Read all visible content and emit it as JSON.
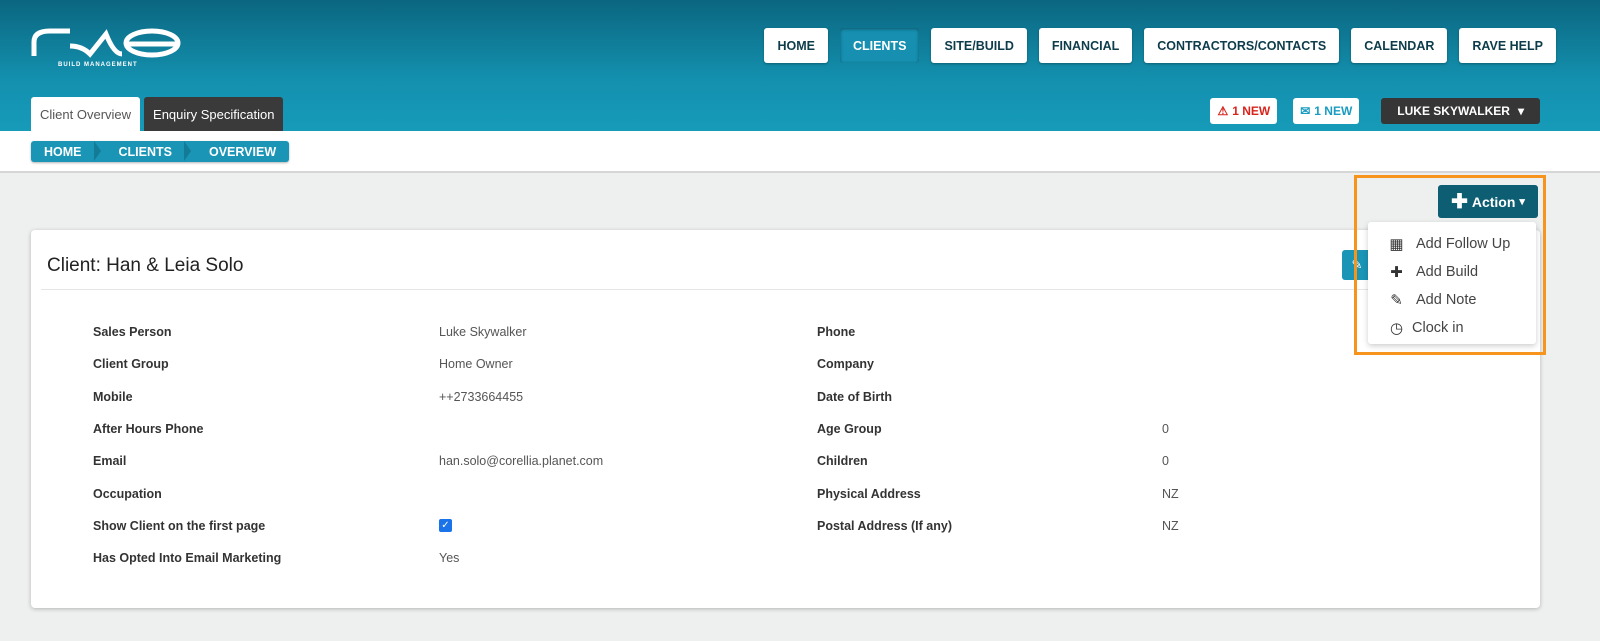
{
  "brand": {
    "logo_text": "rave",
    "tagline": "BUILD MANAGEMENT"
  },
  "nav": [
    "HOME",
    "CLIENTS",
    "SITE/BUILD",
    "FINANCIAL",
    "CONTRACTORS/CONTACTS",
    "CALENDAR",
    "RAVE HELP"
  ],
  "tabs": [
    "Client Overview",
    "Enquiry Specification"
  ],
  "alerts": {
    "warning": "1 NEW",
    "mail": "1 NEW",
    "user": "LUKE SKYWALKER"
  },
  "breadcrumb": [
    "HOME",
    "CLIENTS",
    "OVERVIEW"
  ],
  "action": {
    "label": "Action",
    "items": [
      {
        "icon": "calendar-icon",
        "label": "Add Follow Up"
      },
      {
        "icon": "plus-icon",
        "label": "Add Build"
      },
      {
        "icon": "pencil-icon",
        "label": "Add Note"
      },
      {
        "icon": "clock-icon",
        "label": "Clock in"
      }
    ]
  },
  "client": {
    "title": "Client: Han & Leia Solo",
    "left": [
      {
        "label": "Sales Person",
        "value": "Luke Skywalker"
      },
      {
        "label": "Client Group",
        "value": "Home Owner"
      },
      {
        "label": "Mobile",
        "value": "++2733664455"
      },
      {
        "label": "After Hours Phone",
        "value": ""
      },
      {
        "label": "Email",
        "value": "han.solo@corellia.planet.com"
      },
      {
        "label": "Occupation",
        "value": ""
      },
      {
        "label": "Show Client on the first page",
        "value": ""
      },
      {
        "label": "Has Opted Into Email Marketing",
        "value": "Yes"
      }
    ],
    "right": [
      {
        "label": "Phone",
        "value": ""
      },
      {
        "label": "Company",
        "value": ""
      },
      {
        "label": "Date of Birth",
        "value": ""
      },
      {
        "label": "Age Group",
        "value": "0"
      },
      {
        "label": "Children",
        "value": "0"
      },
      {
        "label": "Physical Address",
        "value": "NZ"
      },
      {
        "label": "Postal Address (If any)",
        "value": "NZ"
      }
    ],
    "show_first_page": true
  },
  "colors": {
    "accent": "#1a95b6",
    "action": "#0d5e72",
    "highlight": "#f7941d"
  }
}
